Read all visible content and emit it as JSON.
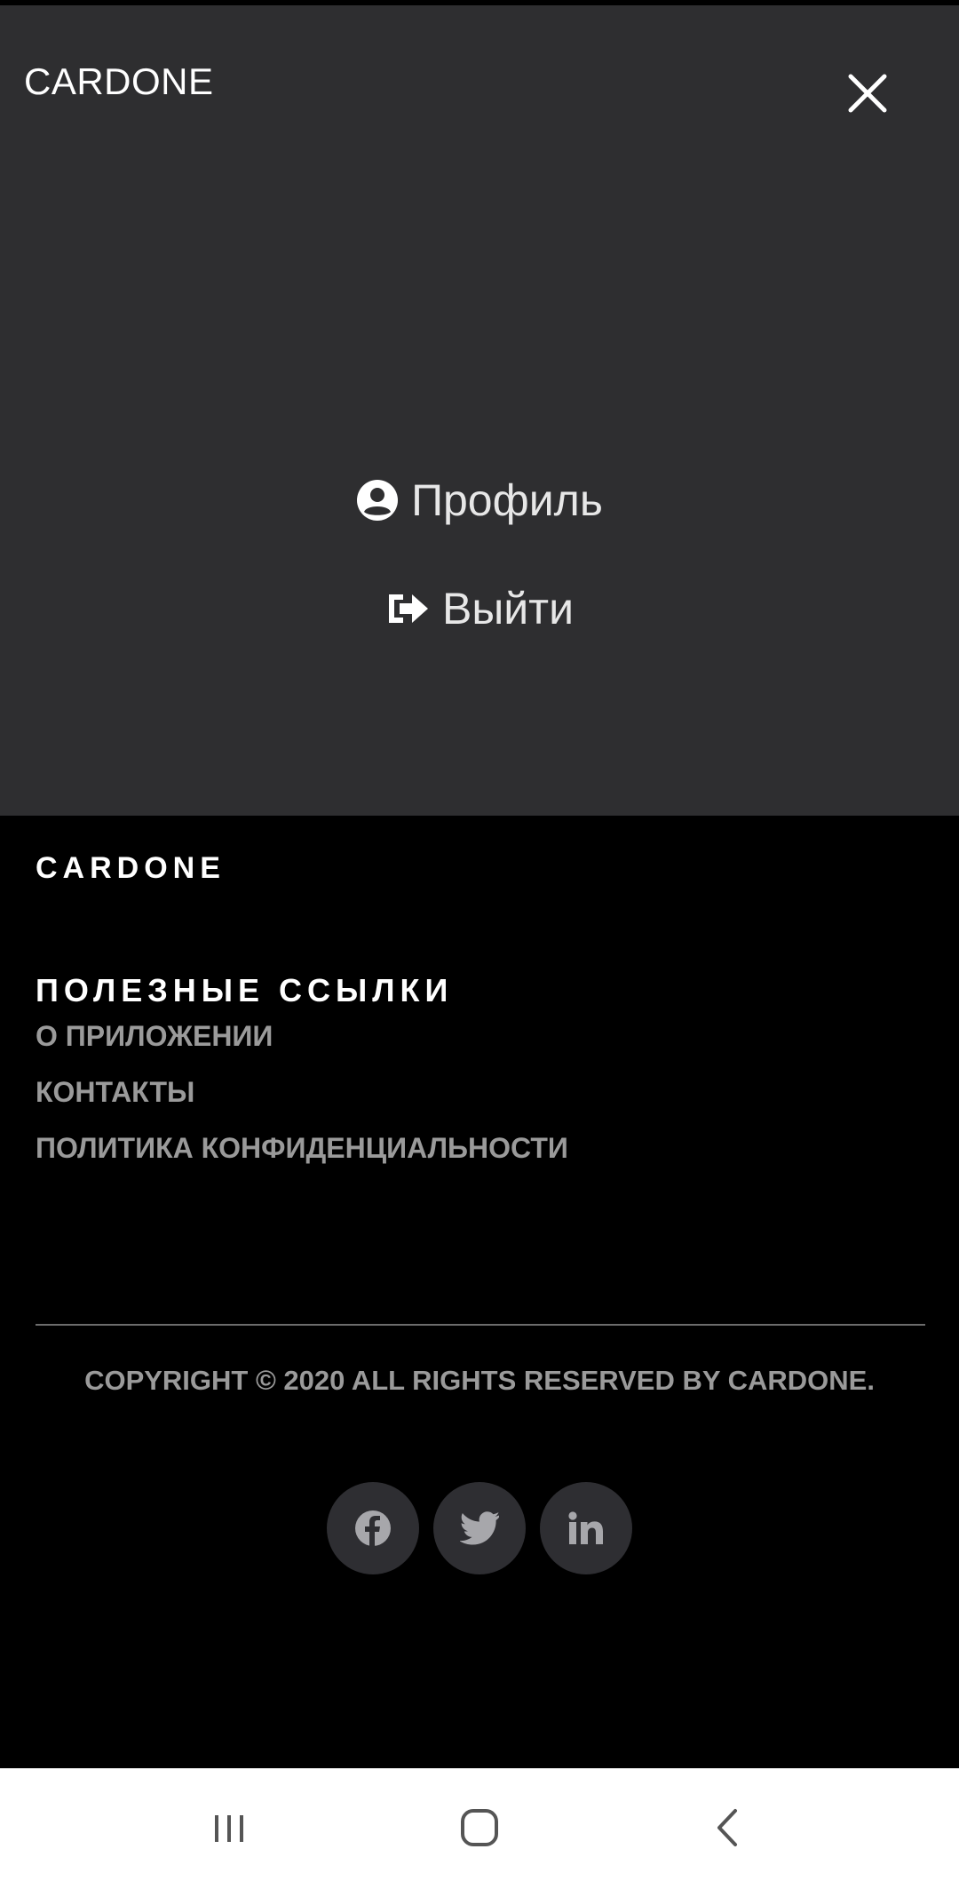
{
  "header": {
    "brand": "CARDONE",
    "close_icon": "close-icon"
  },
  "menu": {
    "items": [
      {
        "label": "Профиль",
        "icon": "user-circle-icon"
      },
      {
        "label": "Выйти",
        "icon": "sign-out-icon"
      }
    ]
  },
  "footer": {
    "brand": "CARDONE",
    "links_heading": "ПОЛЕЗНЫЕ ССЫЛКИ",
    "links": [
      {
        "label": "О ПРИЛОЖЕНИИ"
      },
      {
        "label": "КОНТАКТЫ"
      },
      {
        "label": "ПОЛИТИКА КОНФИДЕНЦИАЛЬНОСТИ"
      }
    ],
    "copyright": "COPYRIGHT © 2020 ALL RIGHTS RESERVED BY CARDONE.",
    "socials": [
      {
        "icon": "facebook-icon"
      },
      {
        "icon": "twitter-icon"
      },
      {
        "icon": "linkedin-icon"
      }
    ]
  },
  "system_nav": {
    "buttons": [
      {
        "icon": "recent-apps-icon"
      },
      {
        "icon": "home-icon"
      },
      {
        "icon": "back-icon"
      }
    ]
  },
  "colors": {
    "menu_bg": "#2e2e30",
    "footer_bg": "#000000",
    "muted_text": "#9a9a9a",
    "social_bg": "#2e2e32"
  }
}
